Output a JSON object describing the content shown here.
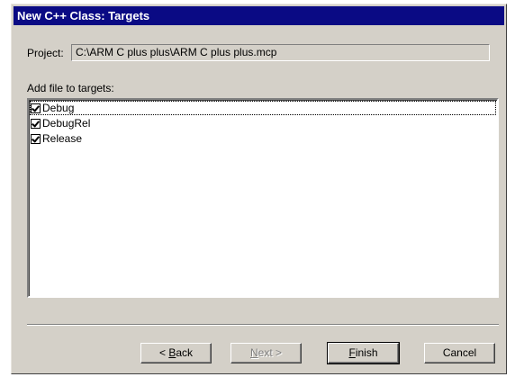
{
  "window": {
    "title": "New C++ Class: Targets"
  },
  "project": {
    "label": "Project:",
    "value": "C:\\ARM C plus plus\\ARM C plus plus.mcp"
  },
  "targets": {
    "label": "Add file to targets:",
    "items": [
      {
        "name": "Debug",
        "checked": true
      },
      {
        "name": "DebugRel",
        "checked": true
      },
      {
        "name": "Release",
        "checked": true
      }
    ]
  },
  "buttons": {
    "back": {
      "prefix": "< ",
      "mnemonic": "B",
      "rest": "ack"
    },
    "next": {
      "mnemonic": "N",
      "rest": "ext >"
    },
    "finish": {
      "mnemonic": "F",
      "rest": "inish"
    },
    "cancel": "Cancel"
  }
}
